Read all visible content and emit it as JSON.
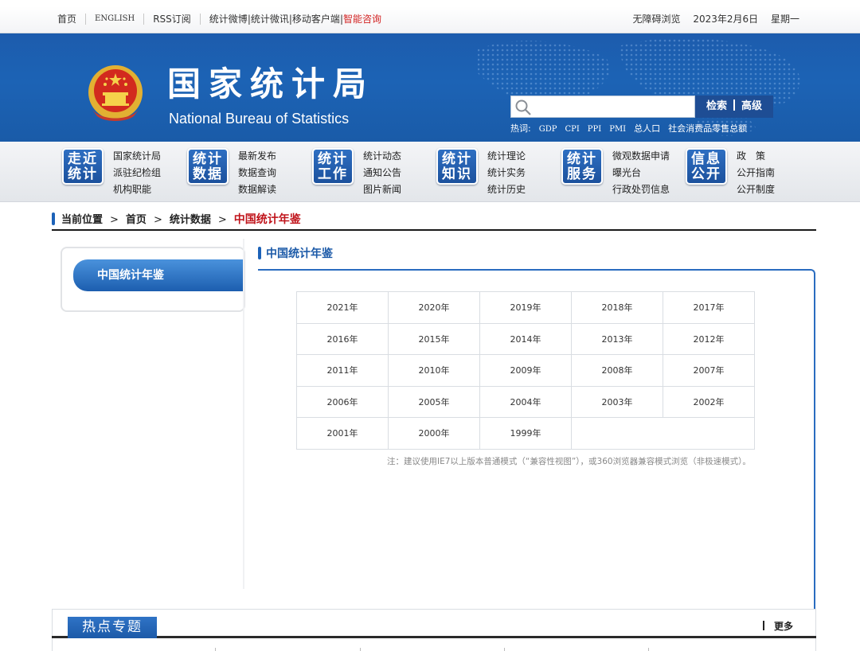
{
  "topbar": {
    "home": "首页",
    "english": "ENGLISH",
    "rss": "RSS订阅",
    "weibo": "统计微博",
    "weixin": "统计微讯",
    "mobile": "移动客户端",
    "smart": "智能咨询",
    "accessible": "无障碍浏览",
    "date": "2023年2月6日",
    "weekday": "星期一"
  },
  "banner": {
    "title_cn": "国家统计局",
    "title_en": "National Bureau of Statistics",
    "search_placeholder": "",
    "search_label": "检索",
    "advanced_label": "高级",
    "hotwords_label": "热词:",
    "hotwords": [
      "GDP",
      "CPI",
      "PPI",
      "PMI",
      "总人口",
      "社会消费品零售总额"
    ]
  },
  "nav": [
    {
      "box1": "走近",
      "box2": "统计",
      "links": [
        "国家统计局",
        "派驻纪检组",
        "机构职能"
      ]
    },
    {
      "box1": "统计",
      "box2": "数据",
      "links": [
        "最新发布",
        "数据查询",
        "数据解读"
      ]
    },
    {
      "box1": "统计",
      "box2": "工作",
      "links": [
        "统计动态",
        "通知公告",
        "图片新闻"
      ]
    },
    {
      "box1": "统计",
      "box2": "知识",
      "links": [
        "统计理论",
        "统计实务",
        "统计历史"
      ]
    },
    {
      "box1": "统计",
      "box2": "服务",
      "links": [
        "微观数据申请",
        "曝光台",
        "行政处罚信息"
      ]
    },
    {
      "box1": "信息",
      "box2": "公开",
      "links": [
        "政　策",
        "公开指南",
        "公开制度"
      ]
    }
  ],
  "breadcrumb": {
    "label": "当前位置",
    "items": [
      "首页",
      "统计数据",
      "中国统计年鉴"
    ]
  },
  "sidebar": {
    "item": "中国统计年鉴"
  },
  "content": {
    "title": "中国统计年鉴",
    "years": [
      [
        "2021年",
        "2020年",
        "2019年",
        "2018年",
        "2017年"
      ],
      [
        "2016年",
        "2015年",
        "2014年",
        "2013年",
        "2012年"
      ],
      [
        "2011年",
        "2010年",
        "2009年",
        "2008年",
        "2007年"
      ],
      [
        "2006年",
        "2005年",
        "2004年",
        "2003年",
        "2002年"
      ],
      [
        "2001年",
        "2000年",
        "1999年"
      ]
    ],
    "note": "注：建议使用IE7以上版本普通模式（“兼容性视图”），或360浏览器兼容模式浏览（非极速模式）。"
  },
  "hot": {
    "title": "热点专题",
    "more": "更多"
  },
  "colors": {
    "brand_blue": "#1c5aa8",
    "current_red": "#c0141b"
  }
}
